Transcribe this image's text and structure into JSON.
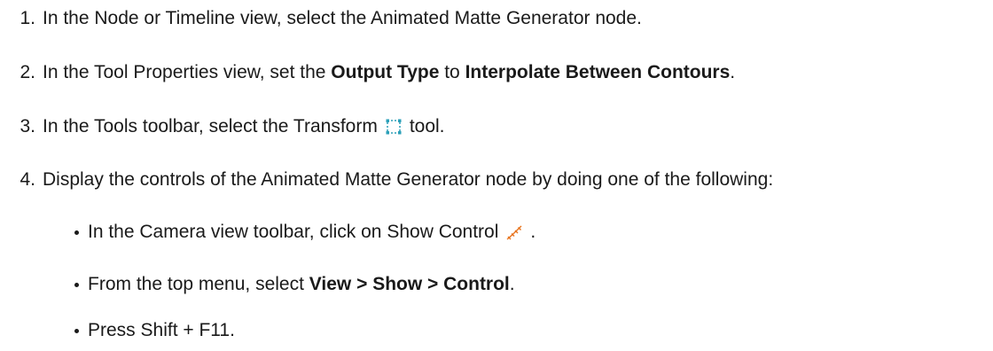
{
  "steps": [
    {
      "num": "1.",
      "text": "In the Node or Timeline view, select the Animated Matte Generator node."
    },
    {
      "num": "2.",
      "pre": "In the Tool Properties view, set the ",
      "bold1": "Output Type",
      "mid": " to ",
      "bold2": "Interpolate Between Contours",
      "post": "."
    },
    {
      "num": "3.",
      "pre": "In the Tools toolbar, select the Transform",
      "icon": "transform-tool-icon",
      "post": "tool."
    },
    {
      "num": "4.",
      "text": "Display the controls of the Animated Matte Generator node by doing one of the following:"
    }
  ],
  "bullets": [
    {
      "pre": "In the Camera view toolbar, click on Show Control",
      "icon": "show-control-icon",
      "post": "."
    },
    {
      "pre": "From the top menu, select ",
      "bold": "View > Show > Control",
      "post": "."
    },
    {
      "text": "Press Shift + F11."
    }
  ],
  "colors": {
    "text": "#1a1a1a",
    "transform_icon": "#2a9fb8",
    "show_control_icon": "#e8741e"
  }
}
